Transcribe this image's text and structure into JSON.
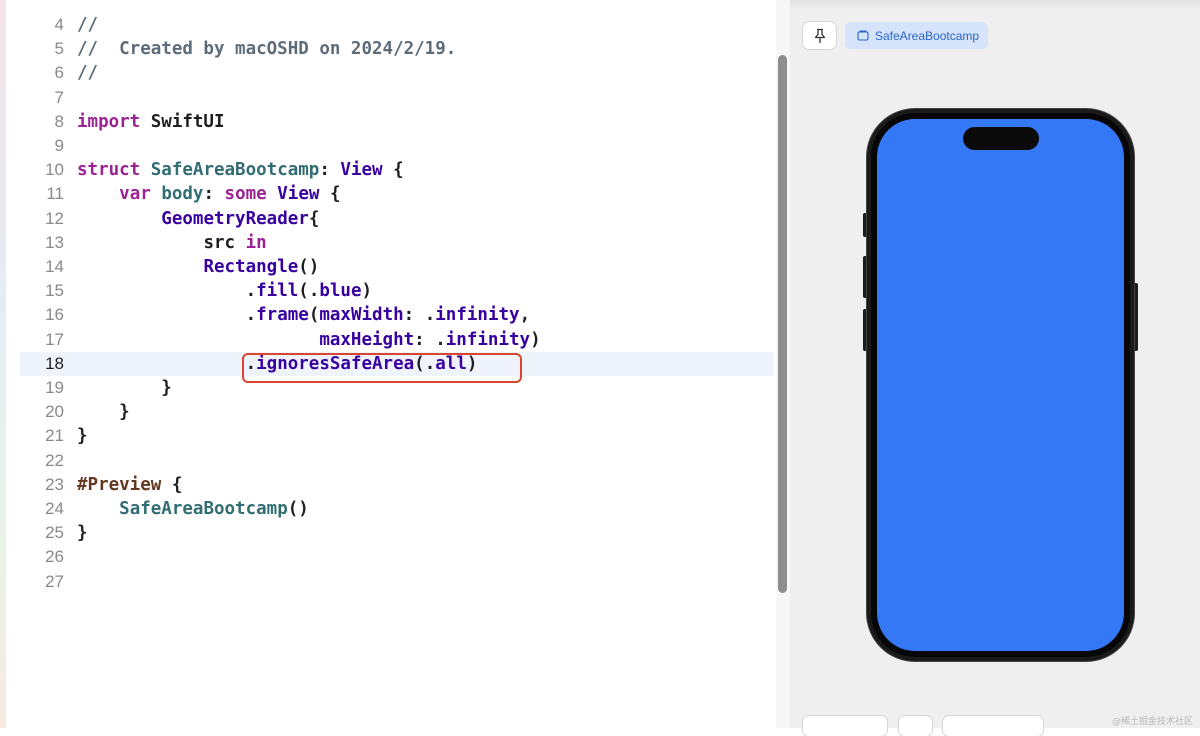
{
  "editor": {
    "lines": [
      {
        "n": "4",
        "tokens": [
          {
            "t": "//",
            "c": "cm"
          }
        ]
      },
      {
        "n": "5",
        "tokens": [
          {
            "t": "//  Created by macOSHD on 2024/2/19.",
            "c": "cm"
          }
        ]
      },
      {
        "n": "6",
        "tokens": [
          {
            "t": "//",
            "c": "cm"
          }
        ]
      },
      {
        "n": "7",
        "tokens": []
      },
      {
        "n": "8",
        "tokens": [
          {
            "t": "import",
            "c": "kw"
          },
          {
            "t": " SwiftUI",
            "c": "pl"
          }
        ]
      },
      {
        "n": "9",
        "tokens": []
      },
      {
        "n": "10",
        "tokens": [
          {
            "t": "struct",
            "c": "kw"
          },
          {
            "t": " ",
            "c": ""
          },
          {
            "t": "SafeAreaBootcamp",
            "c": "fn"
          },
          {
            "t": ": ",
            "c": "pl"
          },
          {
            "t": "View",
            "c": "tp"
          },
          {
            "t": " {",
            "c": "pl"
          }
        ]
      },
      {
        "n": "11",
        "tokens": [
          {
            "t": "    ",
            "c": ""
          },
          {
            "t": "var",
            "c": "kw"
          },
          {
            "t": " ",
            "c": ""
          },
          {
            "t": "body",
            "c": "fn"
          },
          {
            "t": ": ",
            "c": "pl"
          },
          {
            "t": "some",
            "c": "kw"
          },
          {
            "t": " ",
            "c": ""
          },
          {
            "t": "View",
            "c": "tp"
          },
          {
            "t": " {",
            "c": "pl"
          }
        ]
      },
      {
        "n": "12",
        "tokens": [
          {
            "t": "        ",
            "c": ""
          },
          {
            "t": "GeometryReader",
            "c": "tp"
          },
          {
            "t": "{",
            "c": "pl"
          }
        ]
      },
      {
        "n": "13",
        "tokens": [
          {
            "t": "            ",
            "c": ""
          },
          {
            "t": "src",
            "c": "pl"
          },
          {
            "t": " ",
            "c": ""
          },
          {
            "t": "in",
            "c": "kw"
          }
        ]
      },
      {
        "n": "14",
        "tokens": [
          {
            "t": "            ",
            "c": ""
          },
          {
            "t": "Rectangle",
            "c": "tp"
          },
          {
            "t": "()",
            "c": "pl"
          }
        ]
      },
      {
        "n": "15",
        "tokens": [
          {
            "t": "                ",
            "c": ""
          },
          {
            "t": ".",
            "c": "pl"
          },
          {
            "t": "fill",
            "c": "tp"
          },
          {
            "t": "(.",
            "c": "pl"
          },
          {
            "t": "blue",
            "c": "tp"
          },
          {
            "t": ")",
            "c": "pl"
          }
        ]
      },
      {
        "n": "16",
        "tokens": [
          {
            "t": "                ",
            "c": ""
          },
          {
            "t": ".",
            "c": "pl"
          },
          {
            "t": "frame",
            "c": "tp"
          },
          {
            "t": "(",
            "c": "pl"
          },
          {
            "t": "maxWidth",
            "c": "tp"
          },
          {
            "t": ": .",
            "c": "pl"
          },
          {
            "t": "infinity",
            "c": "tp"
          },
          {
            "t": ",",
            "c": "pl"
          }
        ]
      },
      {
        "n": "17",
        "tokens": [
          {
            "t": "                       ",
            "c": ""
          },
          {
            "t": "maxHeight",
            "c": "tp"
          },
          {
            "t": ": .",
            "c": "pl"
          },
          {
            "t": "infinity",
            "c": "tp"
          },
          {
            "t": ")",
            "c": "pl"
          }
        ]
      },
      {
        "n": "18",
        "tokens": [
          {
            "t": "                ",
            "c": ""
          },
          {
            "t": ".",
            "c": "pl"
          },
          {
            "t": "ignoresSafeArea",
            "c": "tp"
          },
          {
            "t": "(.",
            "c": "pl"
          },
          {
            "t": "all",
            "c": "tp"
          },
          {
            "t": ")",
            "c": "pl"
          }
        ],
        "current": true
      },
      {
        "n": "19",
        "tokens": [
          {
            "t": "        }",
            "c": "pl"
          }
        ]
      },
      {
        "n": "20",
        "tokens": [
          {
            "t": "    }",
            "c": "pl"
          }
        ]
      },
      {
        "n": "21",
        "tokens": [
          {
            "t": "}",
            "c": "pl"
          }
        ]
      },
      {
        "n": "22",
        "tokens": []
      },
      {
        "n": "23",
        "tokens": [
          {
            "t": "#Preview",
            "c": "mc"
          },
          {
            "t": " {",
            "c": "pl"
          }
        ]
      },
      {
        "n": "24",
        "tokens": [
          {
            "t": "    ",
            "c": ""
          },
          {
            "t": "SafeAreaBootcamp",
            "c": "fn"
          },
          {
            "t": "()",
            "c": "pl"
          }
        ]
      },
      {
        "n": "25",
        "tokens": [
          {
            "t": "}",
            "c": "pl"
          }
        ]
      },
      {
        "n": "26",
        "tokens": []
      },
      {
        "n": "27",
        "tokens": []
      }
    ]
  },
  "preview": {
    "tab_label": "SafeAreaBootcamp",
    "pin_icon": "pin-icon",
    "screen_color": "#3478f6"
  },
  "watermark": "@稀土掘金技术社区"
}
